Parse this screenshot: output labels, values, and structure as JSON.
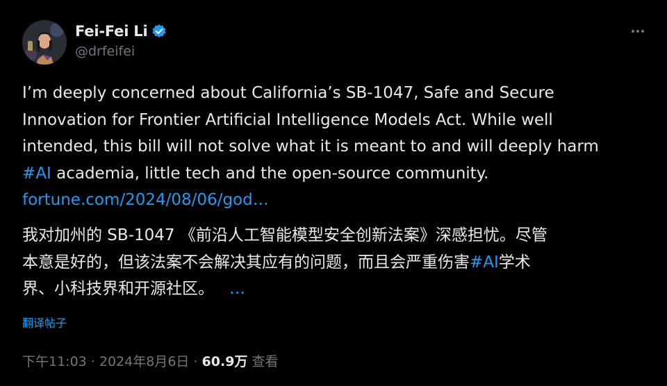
{
  "author": {
    "display_name": "Fei-Fei Li",
    "handle": "@drfeifei",
    "verified_icon": "verified-badge-icon"
  },
  "more_icon": "more-horizontal-icon",
  "post": {
    "en_lines": [
      "I’m deeply concerned about California’s SB-1047, Safe and Secure",
      "Innovation for Frontier Artificial Intelligence Models Act. While well",
      "intended, this bill will not solve what it is meant to and will deeply harm"
    ],
    "en_line4_hashtag": "#AI",
    "en_line4_rest": " academia, little tech and the open-source community.",
    "link": "fortune.com/2024/08/06/god…",
    "zh_line1": "我对加州的 SB-1047 《前沿人工智能模型安全创新法案》深感担忧。尽管",
    "zh_line2_pre": "本意是好的，但该法案不会解决其应有的问题，而且会严重伤害",
    "zh_line2_hashtag": "#AI",
    "zh_line2_post": "学术",
    "zh_line3": "界、小科技界和开源社区。",
    "zh_more": "…"
  },
  "translate_label": "翻译帖子",
  "meta": {
    "time_date": "下午11:03 · 2024年8月6日 · ",
    "views_count": "60.9万",
    "views_label": " 查看"
  },
  "colors": {
    "background": "#000000",
    "text": "#e7e9ea",
    "muted": "#71767b",
    "link": "#1d9bf0"
  }
}
